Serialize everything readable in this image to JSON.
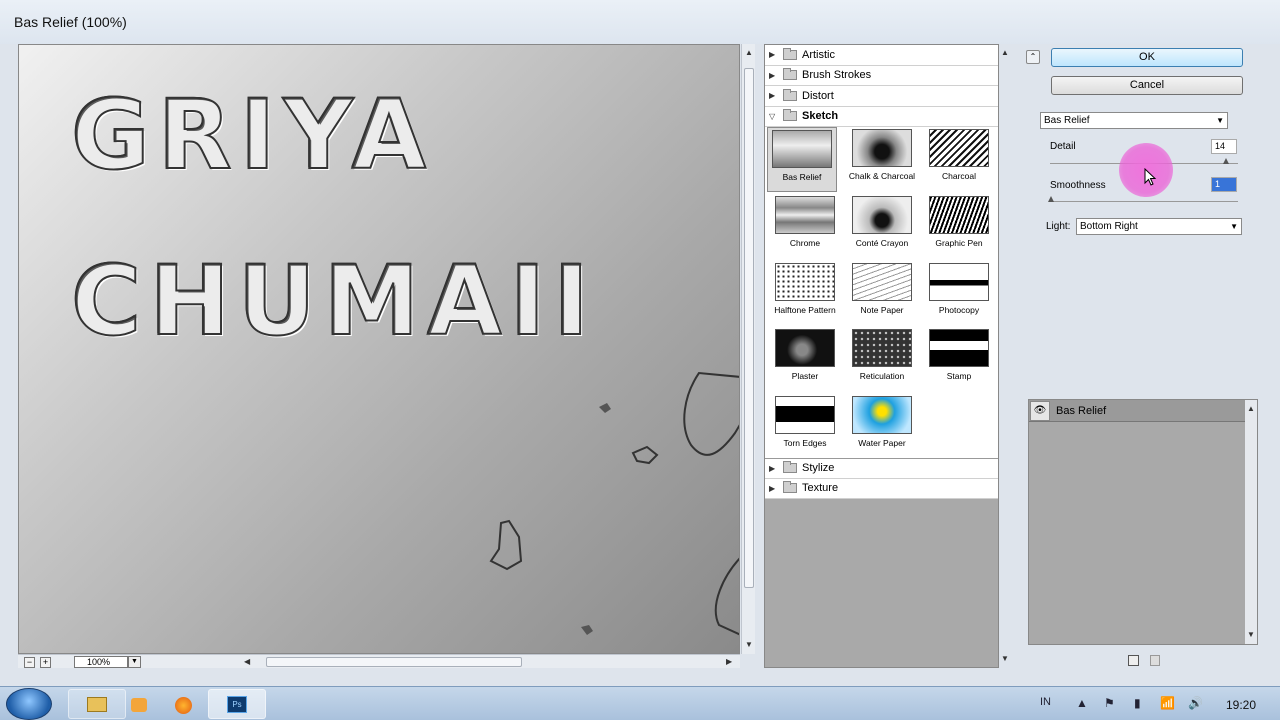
{
  "window": {
    "title": "Bas Relief (100%)"
  },
  "preview": {
    "line1": "GRIYA",
    "line2": "CHUMAII",
    "zoom": "100%",
    "zoom_out": "−",
    "zoom_in": "+"
  },
  "gallery": {
    "categories_top": [
      "Artistic",
      "Brush Strokes",
      "Distort"
    ],
    "open_category": "Sketch",
    "filters": [
      "Bas Relief",
      "Chalk & Charcoal",
      "Charcoal",
      "Chrome",
      "Conté Crayon",
      "Graphic Pen",
      "Halftone Pattern",
      "Note Paper",
      "Photocopy",
      "Plaster",
      "Reticulation",
      "Stamp",
      "Torn Edges",
      "Water Paper"
    ],
    "selected_filter": "Bas Relief",
    "categories_bottom": [
      "Stylize",
      "Texture"
    ]
  },
  "controls": {
    "ok": "OK",
    "cancel": "Cancel",
    "filter_select": "Bas Relief",
    "detail_label": "Detail",
    "detail_value": "14",
    "smoothness_label": "Smoothness",
    "smoothness_value": "1",
    "light_label": "Light:",
    "light_value": "Bottom Right"
  },
  "layers": {
    "items": [
      "Bas Relief"
    ]
  },
  "taskbar": {
    "time": "19:20",
    "lang": "IN"
  }
}
